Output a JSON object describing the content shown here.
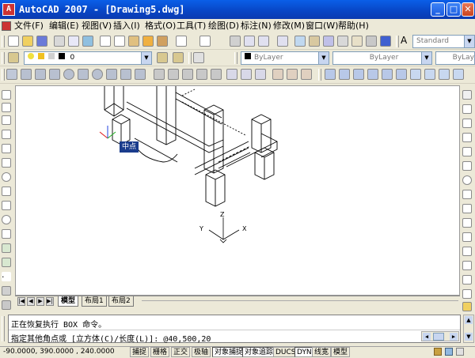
{
  "window": {
    "app_icon": "A",
    "title": "AutoCAD 2007 - [Drawing5.dwg]",
    "buttons": [
      "minimize-icon",
      "maximize-icon",
      "close-icon"
    ]
  },
  "menu": [
    "文件(F)",
    "编辑(E)",
    "视图(V)",
    "插入(I)",
    "格式(O)",
    "工具(T)",
    "绘图(D)",
    "标注(N)",
    "修改(M)",
    "窗口(W)",
    "帮助(H)"
  ],
  "toolbar": {
    "text_style": "Standard",
    "layer": "0",
    "color": "ByLayer",
    "linetype": "ByLayer",
    "lineweight": "ByLay"
  },
  "colors": {
    "title_bar": "#0a52d8",
    "ucs_x": "#e02020",
    "ucs_y": "#20b020",
    "ucs_z": "#2040e0",
    "tooltip_bg": "#1a3c8c"
  },
  "canvas": {
    "tooltip": "中点",
    "axis_labels": {
      "x": "X",
      "y": "Y",
      "z": "Z"
    }
  },
  "tabs": {
    "model": "模型",
    "layout1": "布局1",
    "layout2": "布局2",
    "active": "model"
  },
  "command": {
    "history": "正在恢复执行 BOX 命令。",
    "prompt": "指定其他角点或 [立方体(C)/长度(L)]: @40,500,20"
  },
  "status": {
    "coords": "-90.0000, 390.0000 , 240.0000",
    "toggles": [
      "捕捉",
      "栅格",
      "正交",
      "极轴",
      "对象捕捉",
      "对象追踪",
      "DUCS",
      "DYN",
      "线宽",
      "模型"
    ]
  }
}
